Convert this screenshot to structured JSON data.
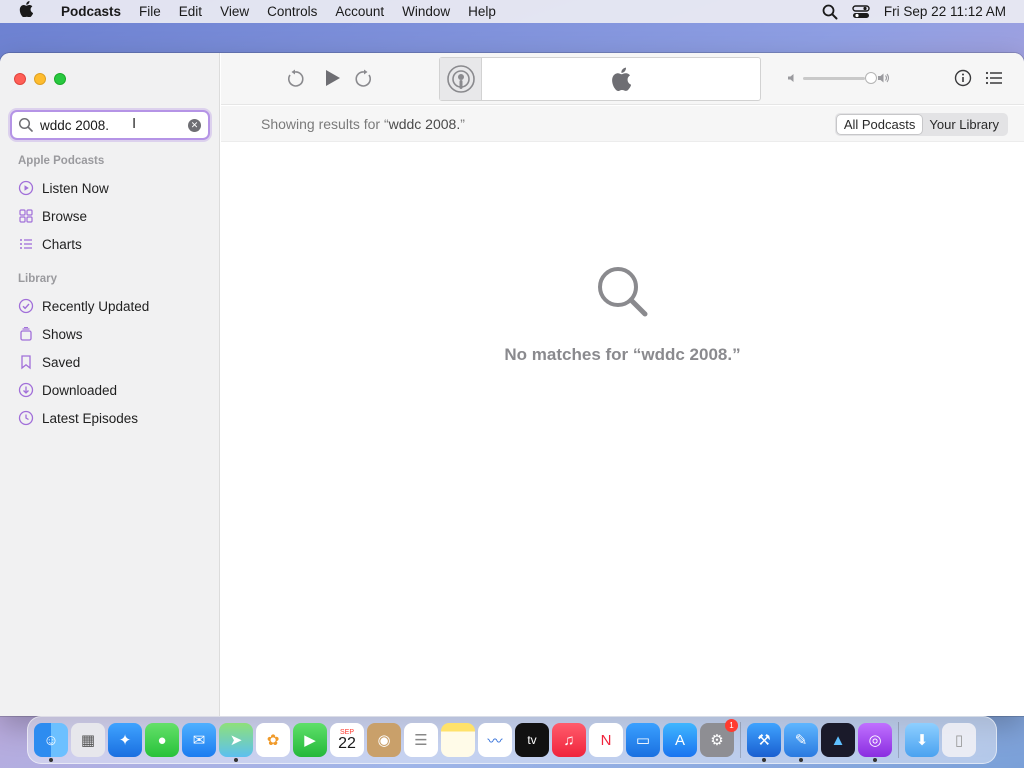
{
  "menubar": {
    "app_name": "Podcasts",
    "menus": [
      "File",
      "Edit",
      "View",
      "Controls",
      "Account",
      "Window",
      "Help"
    ],
    "datetime": "Fri Sep 22  11:12 AM"
  },
  "sidebar": {
    "search": {
      "value": "wddc 2008.",
      "cursor_glyph": "I"
    },
    "section_apple": "Apple Podcasts",
    "apple_items": [
      {
        "label": "Listen Now",
        "icon": "play-circle-icon"
      },
      {
        "label": "Browse",
        "icon": "grid-icon"
      },
      {
        "label": "Charts",
        "icon": "list-icon"
      }
    ],
    "section_library": "Library",
    "library_items": [
      {
        "label": "Recently Updated",
        "icon": "checkmark-circle-icon"
      },
      {
        "label": "Shows",
        "icon": "stack-icon"
      },
      {
        "label": "Saved",
        "icon": "bookmark-icon"
      },
      {
        "label": "Downloaded",
        "icon": "download-circle-icon"
      },
      {
        "label": "Latest Episodes",
        "icon": "clock-circle-icon"
      }
    ]
  },
  "results": {
    "prefix": "Showing results for “",
    "query": "wddc 2008.",
    "suffix": "”",
    "scope_all": "All Podcasts",
    "scope_library": "Your Library"
  },
  "empty_state": {
    "message": "No matches for “wddc 2008.”"
  },
  "dock": {
    "calendar_month": "SEP",
    "calendar_day": "22",
    "settings_badge": "1",
    "tv_label": "tv"
  },
  "colors": {
    "accent": "#b594e6",
    "sidebar_icon": "#a16fd9"
  }
}
